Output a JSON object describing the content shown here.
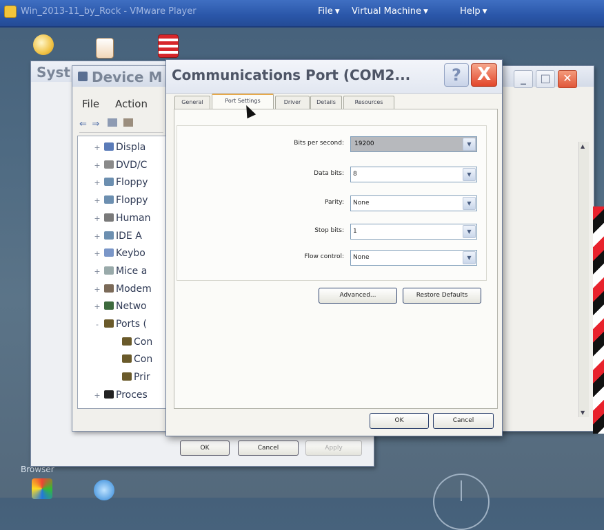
{
  "vm_bar": {
    "title": "Win_2013-11_by_Rock - VMware Player",
    "menus": [
      {
        "label": "File"
      },
      {
        "label": "Virtual Machine"
      },
      {
        "label": "Help"
      }
    ]
  },
  "desktop": {
    "icons": [
      "folder-icon",
      "document-icon",
      "package-icon",
      "game-cube-icon",
      "app-icon"
    ],
    "label": "Browser"
  },
  "system_properties": {
    "title": "Syst",
    "buttons": {
      "ok": "OK",
      "cancel": "Cancel",
      "apply": "Apply"
    }
  },
  "device_manager": {
    "title": "Device M",
    "menu": [
      "File",
      "Action"
    ],
    "tree": [
      {
        "label": "Displa",
        "expander": "+",
        "indent": 0
      },
      {
        "label": "DVD/C",
        "expander": "+",
        "indent": 0
      },
      {
        "label": "Floppy",
        "expander": "+",
        "indent": 0
      },
      {
        "label": "Floppy",
        "expander": "+",
        "indent": 0
      },
      {
        "label": "Human",
        "expander": "+",
        "indent": 0
      },
      {
        "label": "IDE A",
        "expander": "+",
        "indent": 0
      },
      {
        "label": "Keybo",
        "expander": "+",
        "indent": 0
      },
      {
        "label": "Mice a",
        "expander": "+",
        "indent": 0
      },
      {
        "label": "Modem",
        "expander": "+",
        "indent": 0
      },
      {
        "label": "Netwo",
        "expander": "+",
        "indent": 0
      },
      {
        "label": "Ports (",
        "expander": "-",
        "indent": 0
      },
      {
        "label": "Con",
        "expander": "",
        "indent": 1
      },
      {
        "label": "Con",
        "expander": "",
        "indent": 1
      },
      {
        "label": "Prir",
        "expander": "",
        "indent": 1
      },
      {
        "label": "Proces",
        "expander": "+",
        "indent": 0
      }
    ]
  },
  "com_dialog": {
    "title": "Communications Port (COM2...",
    "help": "?",
    "close": "X",
    "tabs": [
      "General",
      "Port Settings",
      "Driver",
      "Details",
      "Resources"
    ],
    "active_tab": "Port Settings",
    "fields": [
      {
        "label": "Bits per second:",
        "value": "19200"
      },
      {
        "label": "Data bits:",
        "value": "8"
      },
      {
        "label": "Parity:",
        "value": "None"
      },
      {
        "label": "Stop bits:",
        "value": "1"
      },
      {
        "label": "Flow control:",
        "value": "None"
      }
    ],
    "advanced": "Advanced...",
    "restore": "Restore Defaults",
    "ok": "OK",
    "cancel": "Cancel"
  }
}
